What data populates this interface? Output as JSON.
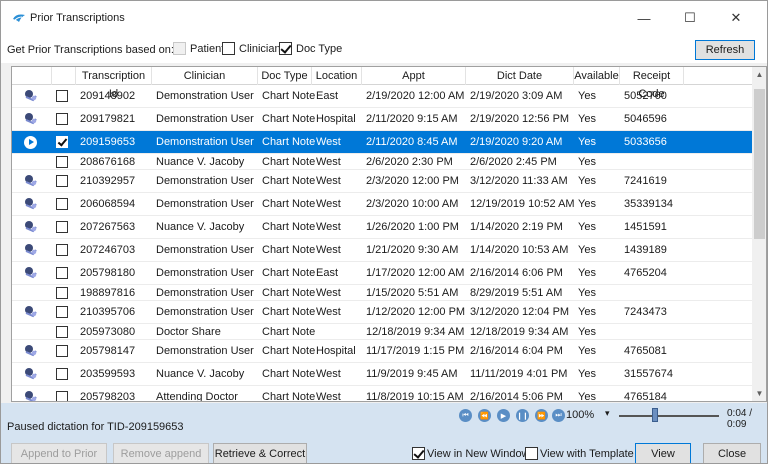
{
  "window": {
    "title": "Prior Transcriptions",
    "min_glyph": "—",
    "max_glyph": "☐",
    "close_glyph": "✕"
  },
  "filter": {
    "label": "Get Prior Transcriptions based on:",
    "options": [
      {
        "label": "Patient",
        "checked": false,
        "enabled": false
      },
      {
        "label": "Clinician",
        "checked": false,
        "enabled": true
      },
      {
        "label": "Doc Type",
        "checked": true,
        "enabled": true
      }
    ],
    "refresh_label": "Refresh"
  },
  "grid": {
    "columns": [
      "Transcription Id",
      "Clinician",
      "Doc Type",
      "Location",
      "Appt",
      "Dict Date",
      "Available",
      "Receipt Code"
    ],
    "rows": [
      {
        "icon": "doc-icon",
        "checked": false,
        "id": "209148902",
        "clinician": "Demonstration User",
        "doctype": "Chart Note",
        "location": "East",
        "appt": "2/19/2020 12:00 AM",
        "dict": "2/19/2020 3:09 AM",
        "available": "Yes",
        "receipt": "5052760"
      },
      {
        "icon": "doc-icon",
        "checked": false,
        "id": "209179821",
        "clinician": "Demonstration User",
        "doctype": "Chart Note",
        "location": "Hospital",
        "appt": "2/11/2020 9:15 AM",
        "dict": "2/19/2020 12:56 PM",
        "available": "Yes",
        "receipt": "5046596"
      },
      {
        "icon": "play-icon",
        "checked": true,
        "selected": true,
        "id": "209159653",
        "clinician": "Demonstration User",
        "doctype": "Chart Note",
        "location": "West",
        "appt": "2/11/2020 8:45 AM",
        "dict": "2/19/2020 9:20 AM",
        "available": "Yes",
        "receipt": "5033656"
      },
      {
        "icon": "",
        "checked": false,
        "short": true,
        "id": "208676168",
        "clinician": "Nuance V. Jacoby",
        "doctype": "Chart Note",
        "location": "West",
        "appt": "2/6/2020 2:30 PM",
        "dict": "2/6/2020 2:45 PM",
        "available": "Yes",
        "receipt": ""
      },
      {
        "icon": "doc-icon",
        "checked": false,
        "id": "210392957",
        "clinician": "Demonstration User",
        "doctype": "Chart Note",
        "location": "West",
        "appt": "2/3/2020 12:00 PM",
        "dict": "3/12/2020 11:33 AM",
        "available": "Yes",
        "receipt": "7241619"
      },
      {
        "icon": "doc-icon",
        "checked": false,
        "id": "206068594",
        "clinician": "Demonstration User",
        "doctype": "Chart Note",
        "location": "West",
        "appt": "2/3/2020 10:00 AM",
        "dict": "12/19/2019 10:52 AM",
        "available": "Yes",
        "receipt": "35339134"
      },
      {
        "icon": "doc-icon",
        "checked": false,
        "id": "207267563",
        "clinician": "Nuance V. Jacoby",
        "doctype": "Chart Note",
        "location": "West",
        "appt": "1/26/2020 1:00 PM",
        "dict": "1/14/2020 2:19 PM",
        "available": "Yes",
        "receipt": "1451591"
      },
      {
        "icon": "doc-icon",
        "checked": false,
        "id": "207246703",
        "clinician": "Demonstration User",
        "doctype": "Chart Note",
        "location": "West",
        "appt": "1/21/2020 9:30 AM",
        "dict": "1/14/2020 10:53 AM",
        "available": "Yes",
        "receipt": "1439189"
      },
      {
        "icon": "doc-icon",
        "checked": false,
        "id": "205798180",
        "clinician": "Demonstration User",
        "doctype": "Chart Note",
        "location": "East",
        "appt": "1/17/2020 12:00 AM",
        "dict": "2/16/2014 6:06 PM",
        "available": "Yes",
        "receipt": "4765204"
      },
      {
        "icon": "",
        "checked": false,
        "short": true,
        "id": "198897816",
        "clinician": "Demonstration User",
        "doctype": "Chart Note",
        "location": "West",
        "appt": "1/15/2020 5:51 AM",
        "dict": "8/29/2019 5:51 AM",
        "available": "Yes",
        "receipt": ""
      },
      {
        "icon": "doc-icon",
        "checked": false,
        "id": "210395706",
        "clinician": "Demonstration User",
        "doctype": "Chart Note",
        "location": "West",
        "appt": "1/12/2020 12:00 PM",
        "dict": "3/12/2020 12:04 PM",
        "available": "Yes",
        "receipt": "7243473"
      },
      {
        "icon": "",
        "checked": false,
        "short": true,
        "id": "205973080",
        "clinician": "Doctor Share",
        "doctype": "Chart Note",
        "location": "",
        "appt": "12/18/2019 9:34 AM",
        "dict": "12/18/2019 9:34 AM",
        "available": "Yes",
        "receipt": ""
      },
      {
        "icon": "doc-icon",
        "checked": false,
        "id": "205798147",
        "clinician": "Demonstration User",
        "doctype": "Chart Note",
        "location": "Hospital",
        "appt": "11/17/2019 1:15 PM",
        "dict": "2/16/2014 6:04 PM",
        "available": "Yes",
        "receipt": "4765081"
      },
      {
        "icon": "doc-icon",
        "checked": false,
        "id": "203599593",
        "clinician": "Nuance V. Jacoby",
        "doctype": "Chart Note",
        "location": "West",
        "appt": "11/9/2019 9:45 AM",
        "dict": "11/11/2019 4:01 PM",
        "available": "Yes",
        "receipt": "31557674"
      },
      {
        "icon": "doc-icon",
        "checked": false,
        "id": "205798203",
        "clinician": "Attending Doctor",
        "doctype": "Chart Note",
        "location": "West",
        "appt": "11/8/2019 10:15 AM",
        "dict": "2/16/2014 5:06 PM",
        "available": "Yes",
        "receipt": "4765184"
      }
    ]
  },
  "player": {
    "status": "Paused dictation for TID-209159653",
    "controls": [
      "skip-start-icon",
      "rewind-icon",
      "play-icon",
      "pause-icon",
      "fast-forward-icon",
      "skip-end-icon"
    ],
    "zoom": "100%",
    "position_fraction": 0.36,
    "time": "0:04 / 0:09"
  },
  "actions": {
    "append_label": "Append to Prior",
    "remove_label": "Remove append",
    "retrieve_label": "Retrieve & Correct",
    "view_new_window_label": "View in New Window",
    "view_new_window_checked": true,
    "view_template_label": "View with Template",
    "view_template_checked": false,
    "view_label": "View",
    "close_label": "Close"
  },
  "colors": {
    "selection": "#0078d7",
    "status_bar": "#d5e3f1",
    "accent": "#0078d7"
  }
}
